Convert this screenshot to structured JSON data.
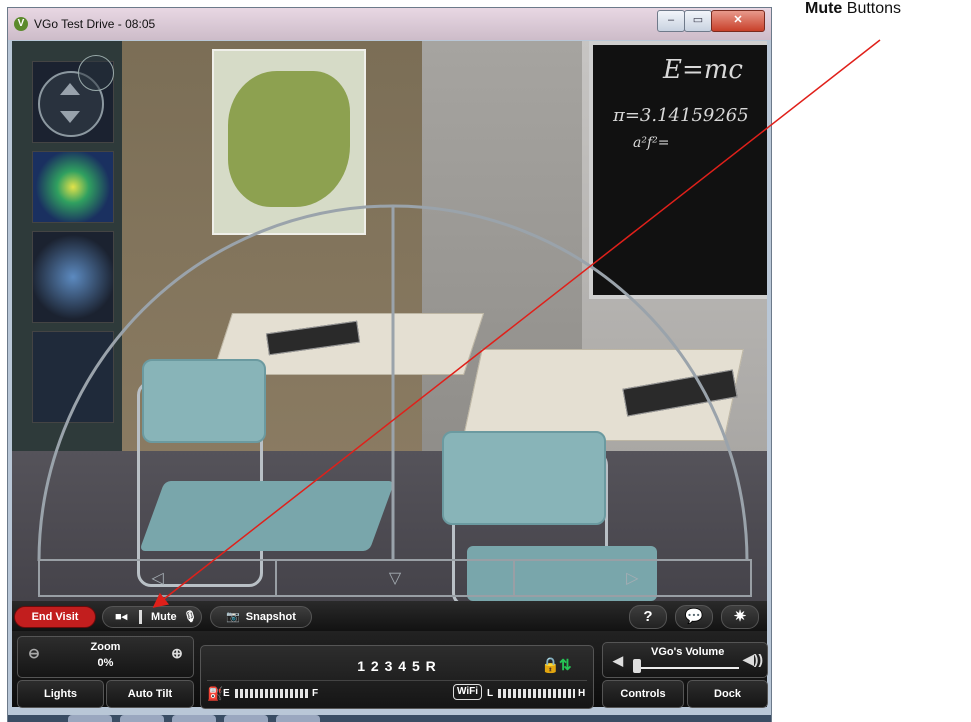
{
  "window": {
    "title": "VGo Test Drive - 08:05",
    "app_icon": "vgo-logo-icon",
    "controls": {
      "minimize": "–",
      "maximize": "▭",
      "close": "✕"
    }
  },
  "annotation": {
    "strong": "Mute",
    "rest": " Buttons",
    "arrow_color": "#e0201a"
  },
  "video": {
    "chalkboard": {
      "line1": "E=mc",
      "line2": "π=3.14159265",
      "line3": "a²f²="
    },
    "drive_arrows": {
      "left": "◁",
      "center": "▽",
      "right": "▷"
    },
    "pan_tilt": {
      "up": "up-arrow-icon",
      "down": "down-arrow-icon"
    }
  },
  "toolbar": {
    "end_visit": "End Visit",
    "cam_icon": "■◂",
    "mute_label": "Mute",
    "mic_icon": "🎙",
    "snapshot_icon": "📷",
    "snapshot_label": "Snapshot",
    "help": "?",
    "chat": "💬",
    "settings": "✷"
  },
  "panel": {
    "zoom_label": "Zoom",
    "zoom_value": "0%",
    "zoom_out": "⊖",
    "zoom_in": "⊕",
    "lights": "Lights",
    "auto_tilt": "Auto Tilt",
    "gears": "1 2 3 4 5 R",
    "lock_icon": "🔒",
    "updown_icon": "⇅",
    "fuel_icon": "⛽",
    "battery_e": "E",
    "battery_f": "F",
    "battery_level": 1.0,
    "wifi": "WiFi",
    "wifi_l": "L",
    "wifi_h": "H",
    "wifi_level": 1.0,
    "vgo_volume_label": "VGo's Volume",
    "vol_low": "◀",
    "vol_high": "◀))",
    "volume_level": 0.0,
    "controls": "Controls",
    "dock": "Dock"
  },
  "colors": {
    "end_visit": "#c21e1e",
    "lock": "#e6b92a",
    "updown": "#25c455"
  }
}
